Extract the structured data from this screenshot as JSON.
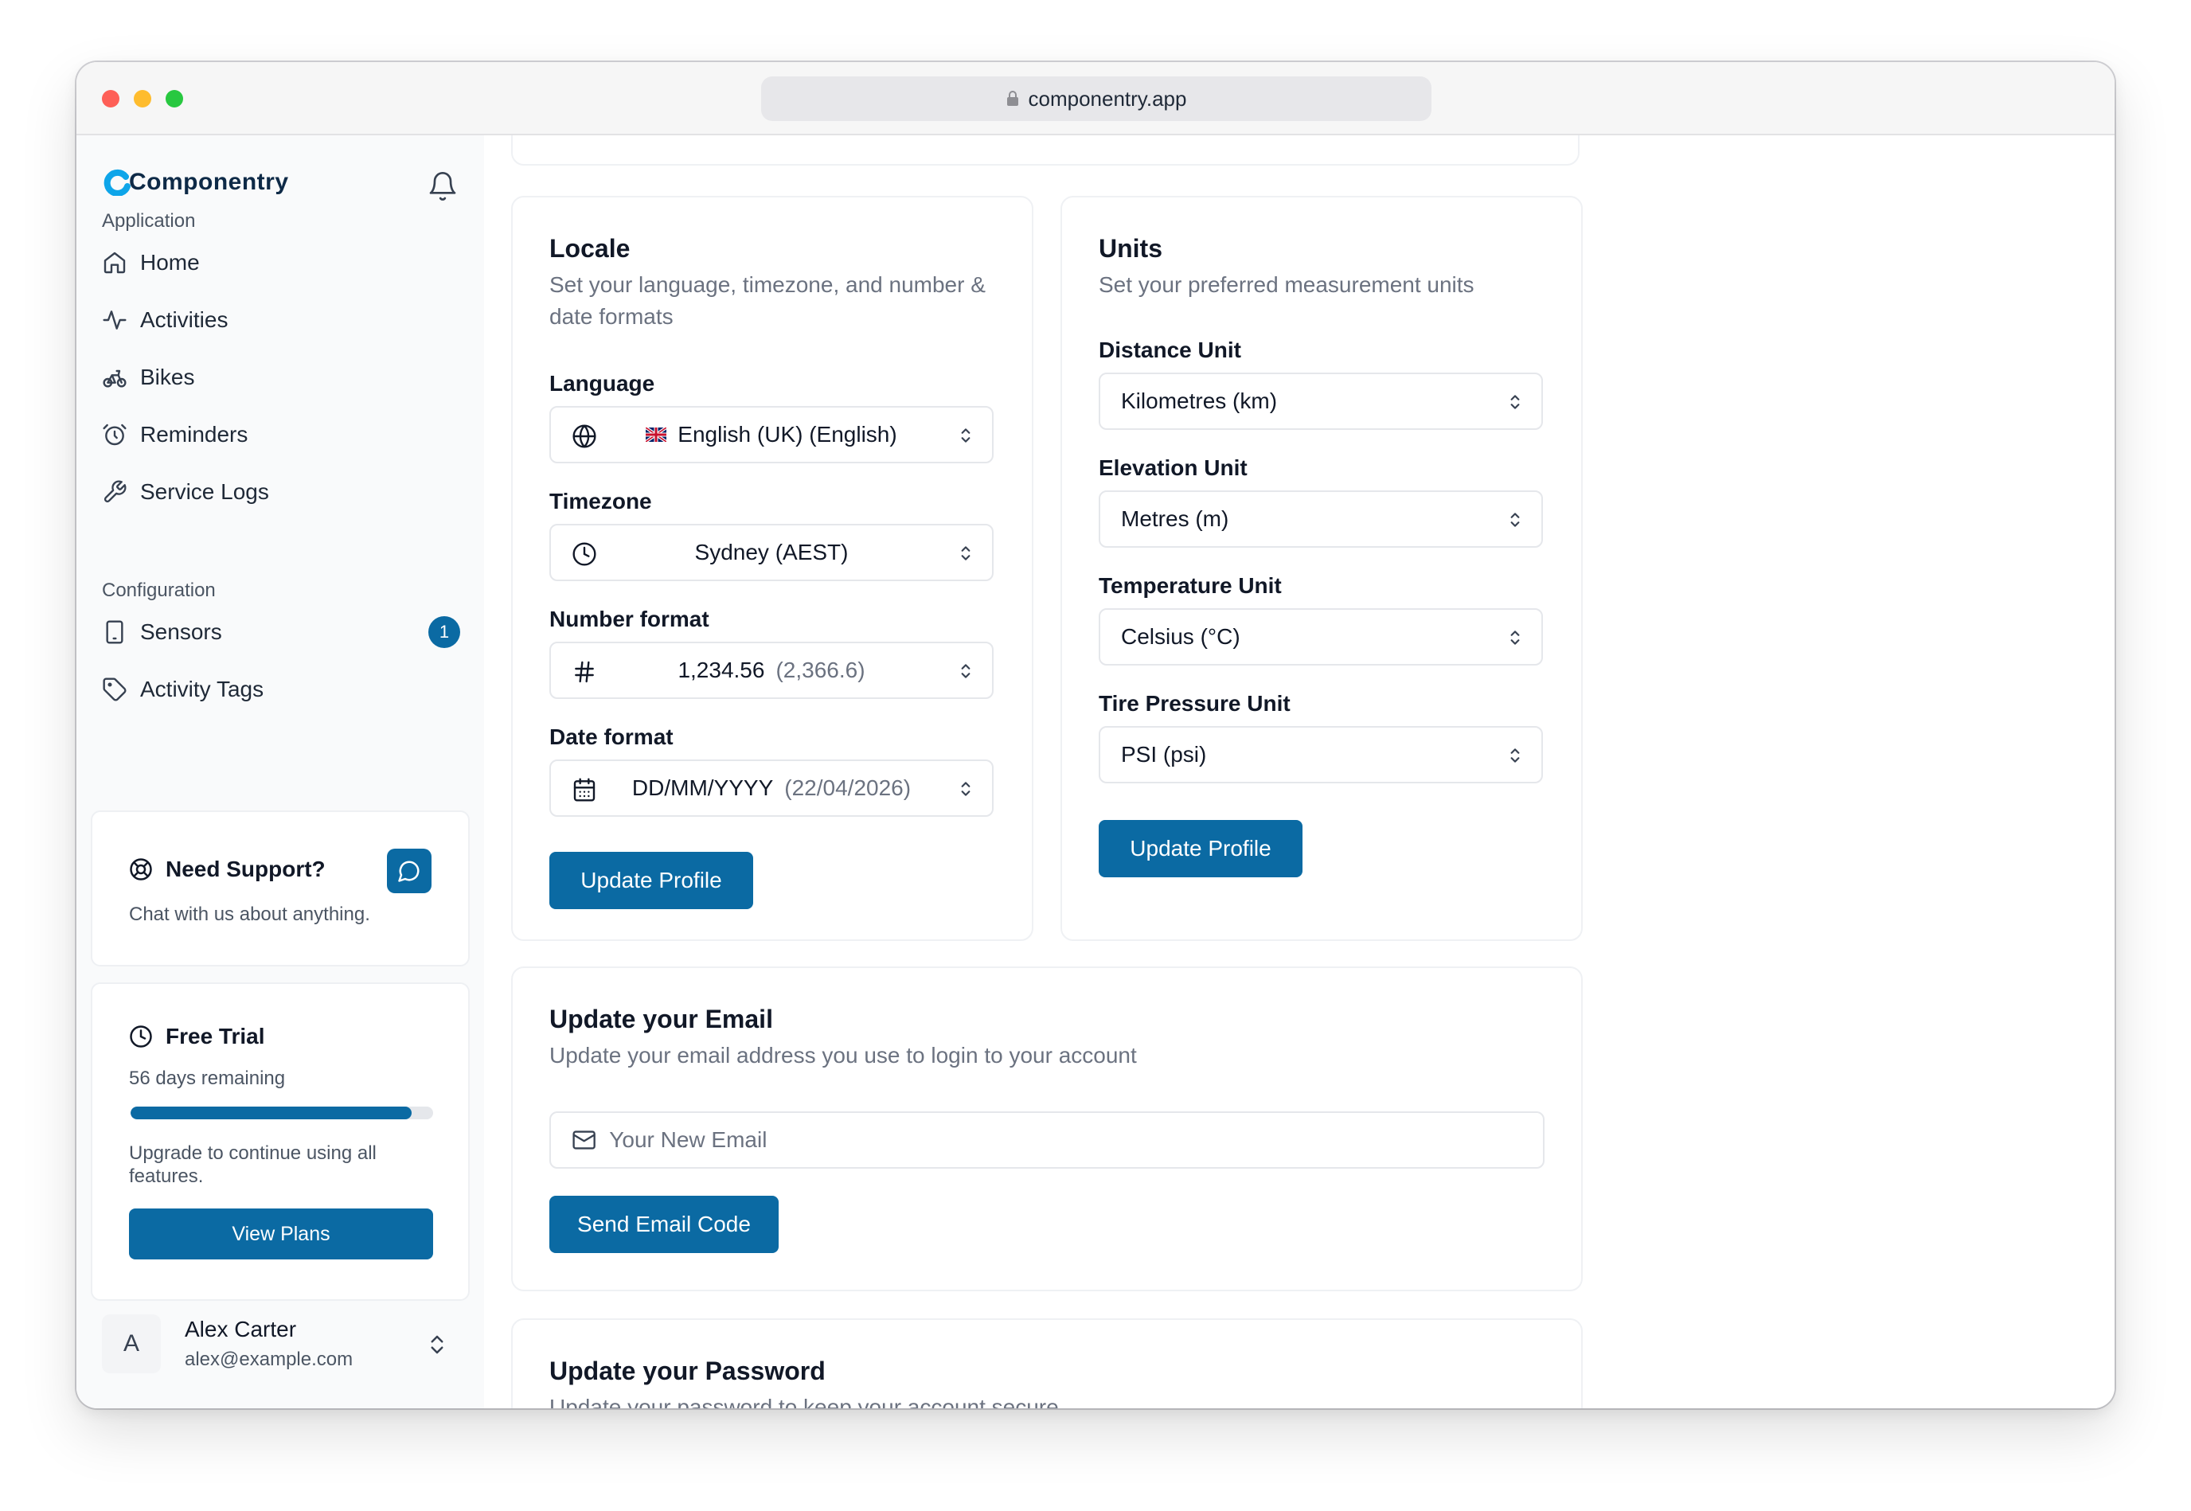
{
  "browser": {
    "url": "componentry.app"
  },
  "app": {
    "name": "Componentry"
  },
  "sidebar": {
    "application_label": "Application",
    "items": [
      {
        "label": "Home",
        "icon": "home-icon"
      },
      {
        "label": "Activities",
        "icon": "activity-icon"
      },
      {
        "label": "Bikes",
        "icon": "bike-icon"
      },
      {
        "label": "Reminders",
        "icon": "alarm-icon"
      },
      {
        "label": "Service Logs",
        "icon": "wrench-icon"
      }
    ],
    "configuration_label": "Configuration",
    "config_items": [
      {
        "label": "Sensors",
        "icon": "tablet-icon",
        "badge": "1"
      },
      {
        "label": "Activity Tags",
        "icon": "tag-icon"
      }
    ],
    "support": {
      "title": "Need Support?",
      "text": "Chat with us about anything."
    },
    "trial": {
      "title": "Free Trial",
      "remaining": "56 days remaining",
      "progress_fraction": 0.93,
      "text": "Upgrade to continue using all features.",
      "button": "View Plans"
    },
    "user": {
      "initial": "A",
      "name": "Alex Carter",
      "email": "alex@example.com"
    }
  },
  "locale": {
    "title": "Locale",
    "description": "Set your language, timezone, and number & date formats",
    "language_label": "Language",
    "language_value": "English (UK) (English)",
    "timezone_label": "Timezone",
    "timezone_value": "Sydney (AEST)",
    "number_label": "Number format",
    "number_value": "1,234.56",
    "number_example": "(2,366.6)",
    "date_label": "Date format",
    "date_value": "DD/MM/YYYY",
    "date_example": "(22/04/2026)",
    "button": "Update Profile"
  },
  "units": {
    "title": "Units",
    "description": "Set your preferred measurement units",
    "distance_label": "Distance Unit",
    "distance_value": "Kilometres (km)",
    "elevation_label": "Elevation Unit",
    "elevation_value": "Metres (m)",
    "temperature_label": "Temperature Unit",
    "temperature_value": "Celsius (°C)",
    "pressure_label": "Tire Pressure Unit",
    "pressure_value": "PSI (psi)",
    "button": "Update Profile"
  },
  "email": {
    "title": "Update your Email",
    "description": "Update your email address you use to login to your account",
    "placeholder": "Your New Email",
    "button": "Send Email Code"
  },
  "password": {
    "title": "Update your Password",
    "description": "Update your password to keep your account secure."
  },
  "colors": {
    "accent": "#0b6aa3",
    "sidebar_bg": "#f9fafb"
  }
}
